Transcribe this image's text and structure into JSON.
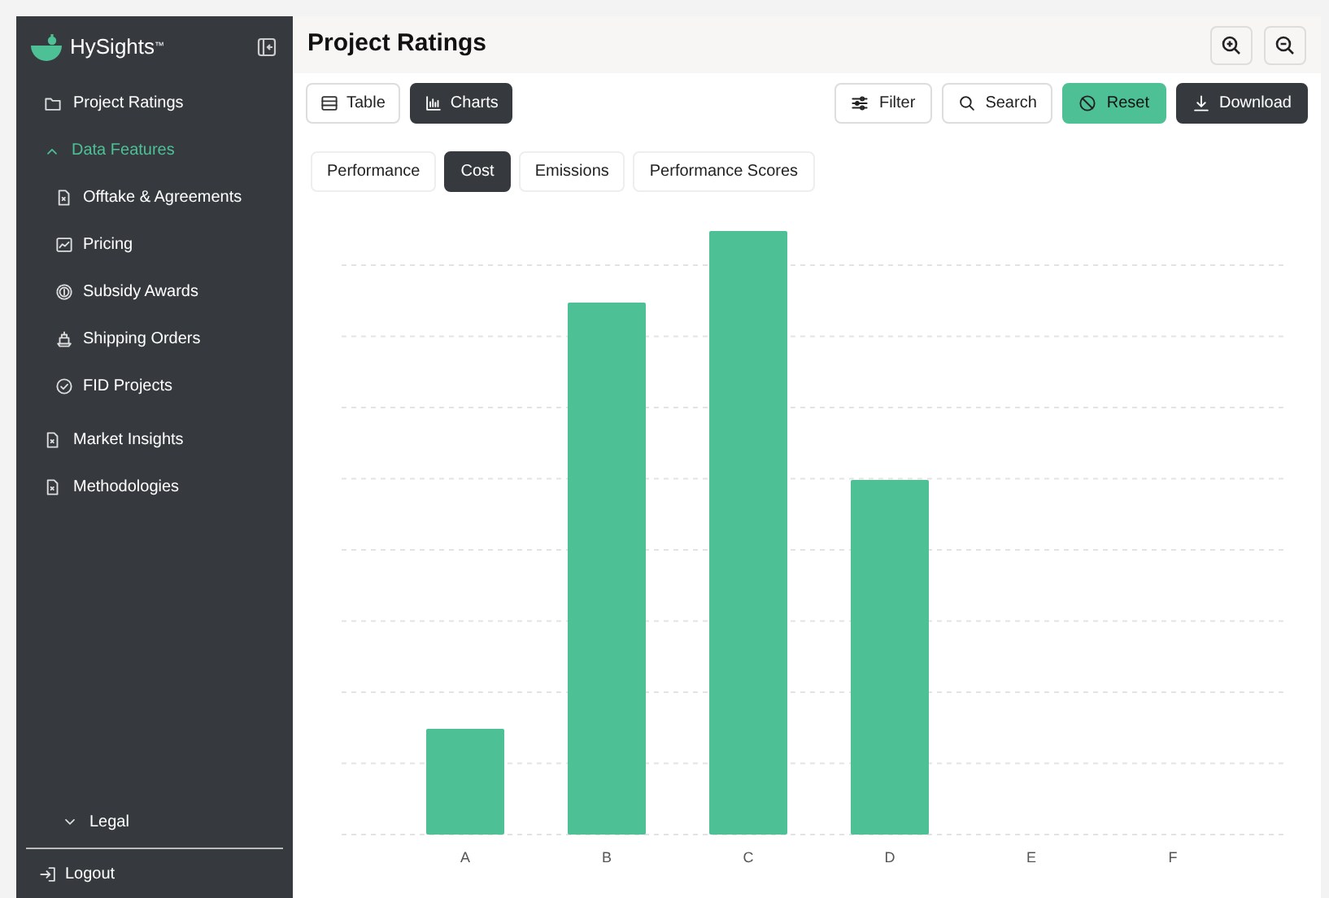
{
  "sidebar": {
    "brand": "HySights",
    "brand_mark": "™",
    "items": [
      {
        "label": "Project Ratings",
        "kind": "folder"
      },
      {
        "label": "Data Features",
        "kind": "group",
        "expanded": true,
        "children": [
          {
            "label": "Offtake & Agreements",
            "kind": "document"
          },
          {
            "label": "Pricing",
            "kind": "chart"
          },
          {
            "label": "Subsidy Awards",
            "kind": "coin"
          },
          {
            "label": "Shipping Orders",
            "kind": "ship"
          },
          {
            "label": "FID Projects",
            "kind": "check"
          }
        ]
      },
      {
        "label": "Market Insights",
        "kind": "document"
      },
      {
        "label": "Methodologies",
        "kind": "document"
      }
    ],
    "legal": {
      "label": "Legal",
      "expanded": false
    },
    "logout": "Logout"
  },
  "header": {
    "title": "Project Ratings"
  },
  "view_toggle": [
    {
      "label": "Table",
      "kind": "table",
      "selected": false
    },
    {
      "label": "Charts",
      "kind": "chart",
      "selected": true
    }
  ],
  "actions": [
    {
      "label": "Filter",
      "kind": "filter"
    },
    {
      "label": "Search",
      "kind": "search"
    },
    {
      "label": "Reset",
      "kind": "reset"
    },
    {
      "label": "Download",
      "kind": "download"
    }
  ],
  "metric_tabs": [
    {
      "label": "Performance",
      "selected": false
    },
    {
      "label": "Cost",
      "selected": true
    },
    {
      "label": "Emissions",
      "selected": false
    },
    {
      "label": "Performance Scores",
      "selected": false
    }
  ],
  "chart": {
    "x_labels": [
      "A",
      "B",
      "C",
      "D",
      "E",
      "F"
    ]
  }
}
